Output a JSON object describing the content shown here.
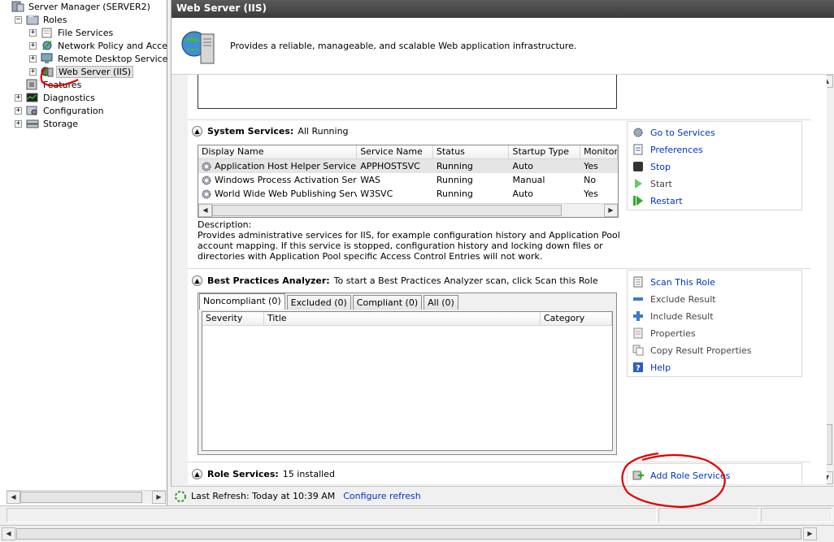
{
  "tree": {
    "root": "Server Manager (SERVER2)",
    "roles": "Roles",
    "file_services": "File Services",
    "network_policy": "Network Policy and Access",
    "remote_desktop": "Remote Desktop Services",
    "web_server": "Web Server (IIS)",
    "features": "Features",
    "diagnostics": "Diagnostics",
    "configuration": "Configuration",
    "storage": "Storage"
  },
  "header": {
    "title": "Web Server (IIS)"
  },
  "description": "Provides a reliable, manageable, and scalable Web application infrastructure.",
  "system_services": {
    "label": "System Services:",
    "summary": "All Running",
    "columns": [
      "Display Name",
      "Service Name",
      "Status",
      "Startup Type",
      "Monitor"
    ],
    "rows": [
      [
        "Application Host Helper Service",
        "APPHOSTSVC",
        "Running",
        "Auto",
        "Yes"
      ],
      [
        "Windows Process Activation Service",
        "WAS",
        "Running",
        "Manual",
        "No"
      ],
      [
        "World Wide Web Publishing Service",
        "W3SVC",
        "Running",
        "Auto",
        "Yes"
      ]
    ],
    "desc_label": "Description:",
    "desc_text": "Provides administrative services for IIS, for example configuration history and Application Pool account mapping. If this service is stopped, configuration history and locking down files or directories with Application Pool specific Access Control Entries will not work.",
    "tasks": [
      "Go to Services",
      "Preferences",
      "Stop",
      "Start",
      "Restart"
    ]
  },
  "bpa": {
    "label": "Best Practices Analyzer:",
    "summary": "To start a Best Practices Analyzer scan, click Scan this Role",
    "tabs": [
      "Noncompliant (0)",
      "Excluded (0)",
      "Compliant (0)",
      "All (0)"
    ],
    "columns": [
      "Severity",
      "Title",
      "Category"
    ],
    "tasks": [
      "Scan This Role",
      "Exclude Result",
      "Include Result",
      "Properties",
      "Copy Result Properties",
      "Help"
    ]
  },
  "role_services": {
    "label": "Role Services:",
    "summary": "15 installed",
    "task": "Add Role Services"
  },
  "status": {
    "last_refresh": "Last Refresh: Today at 10:39 AM",
    "configure": "Configure refresh"
  },
  "colors": {
    "link": "#0033cc",
    "annotation": "#e00000",
    "header_bg": "#4a4a4a"
  }
}
